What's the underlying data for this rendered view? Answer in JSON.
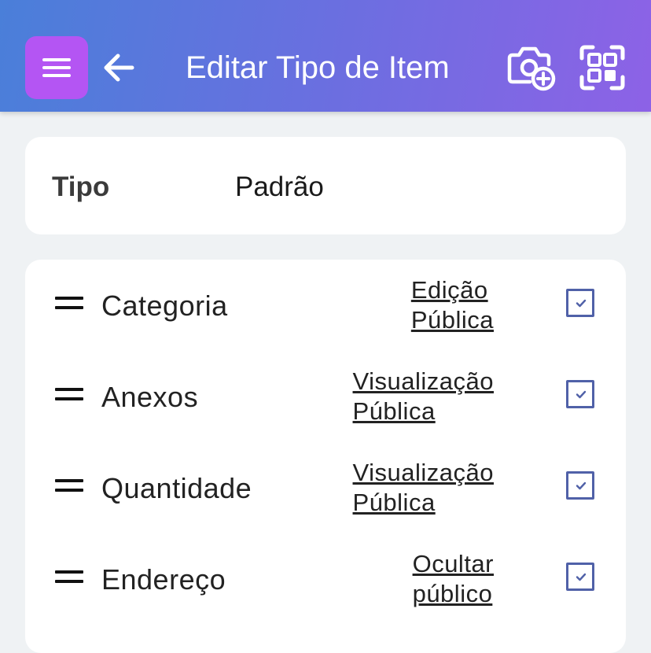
{
  "header": {
    "title": "Editar Tipo de Item",
    "icons": [
      "menu-icon",
      "arrow-left-icon",
      "camera-add-icon",
      "qr-scan-icon"
    ],
    "gradient_colors": [
      "#4a7fd9",
      "#8d62e6"
    ],
    "menu_button_color": "#b455f3"
  },
  "type_card": {
    "label": "Tipo",
    "value": "Padrão"
  },
  "fields": [
    {
      "name": "Categoria",
      "visibility_line1": "Edição",
      "visibility_line2": "Pública",
      "checked": true
    },
    {
      "name": "Anexos",
      "visibility_line1": "Visualização",
      "visibility_line2": "Pública",
      "checked": true
    },
    {
      "name": "Quantidade",
      "visibility_line1": "Visualização",
      "visibility_line2": "Pública",
      "checked": true
    },
    {
      "name": "Endereço",
      "visibility_line1": "Ocultar",
      "visibility_line2": "público",
      "checked": true
    }
  ],
  "colors": {
    "background": "#eff2f4",
    "checkbox_border": "#5061a8"
  }
}
